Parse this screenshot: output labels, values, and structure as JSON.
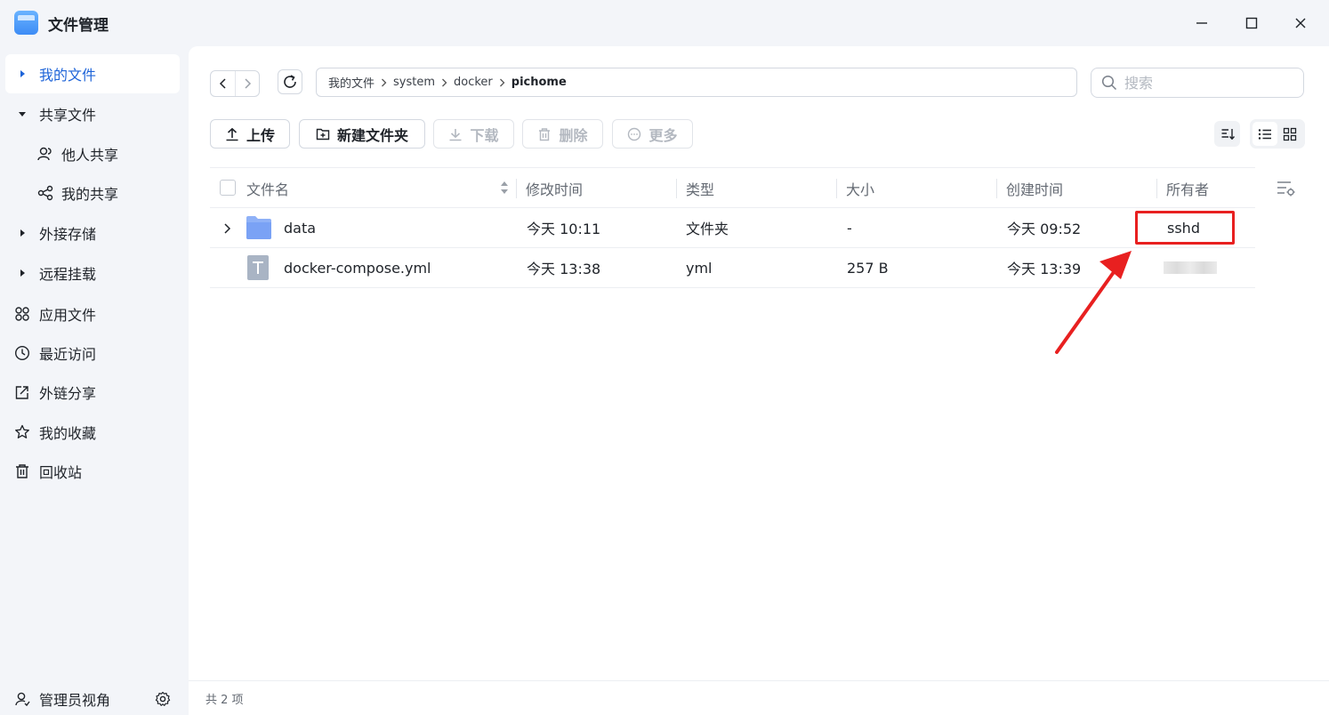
{
  "window": {
    "title": "文件管理"
  },
  "sidebar": {
    "items": [
      {
        "label": "我的文件",
        "icon": "caret-right-icon",
        "active": true
      },
      {
        "label": "共享文件",
        "icon": "caret-down-icon"
      },
      {
        "label": "他人共享",
        "icon": "users-icon",
        "sub": true
      },
      {
        "label": "我的共享",
        "icon": "share-icon",
        "sub": true
      },
      {
        "label": "外接存储",
        "icon": "caret-right-icon"
      },
      {
        "label": "远程挂载",
        "icon": "caret-right-icon"
      },
      {
        "label": "应用文件",
        "icon": "apps-icon"
      },
      {
        "label": "最近访问",
        "icon": "clock-icon"
      },
      {
        "label": "外链分享",
        "icon": "external-link-icon"
      },
      {
        "label": "我的收藏",
        "icon": "star-icon"
      },
      {
        "label": "回收站",
        "icon": "trash-icon"
      }
    ],
    "footer": {
      "label": "管理员视角",
      "icon": "admin-user-icon",
      "settings_icon": "gear-icon"
    }
  },
  "breadcrumb": {
    "parts": [
      "我的文件",
      "system",
      "docker"
    ],
    "current": "pichome"
  },
  "search": {
    "placeholder": "搜索",
    "value": ""
  },
  "toolbar": {
    "upload": "上传",
    "new_folder": "新建文件夹",
    "download": "下载",
    "delete": "删除",
    "more": "更多"
  },
  "table": {
    "headers": {
      "name": "文件名",
      "modified": "修改时间",
      "type": "类型",
      "size": "大小",
      "created": "创建时间",
      "owner": "所有者"
    },
    "rows": [
      {
        "name": "data",
        "kind": "folder",
        "modified": "今天 10:11",
        "type": "文件夹",
        "size": "-",
        "created": "今天 09:52",
        "owner": "sshd"
      },
      {
        "name": "docker-compose.yml",
        "kind": "file",
        "modified": "今天 13:38",
        "type": "yml",
        "size": "257 B",
        "created": "今天 13:39",
        "owner": ""
      }
    ]
  },
  "status": {
    "count_text": "共 2 项"
  },
  "colors": {
    "accent": "#1e64d8",
    "annotation": "#e82020",
    "folder": "#7aa2f5"
  }
}
